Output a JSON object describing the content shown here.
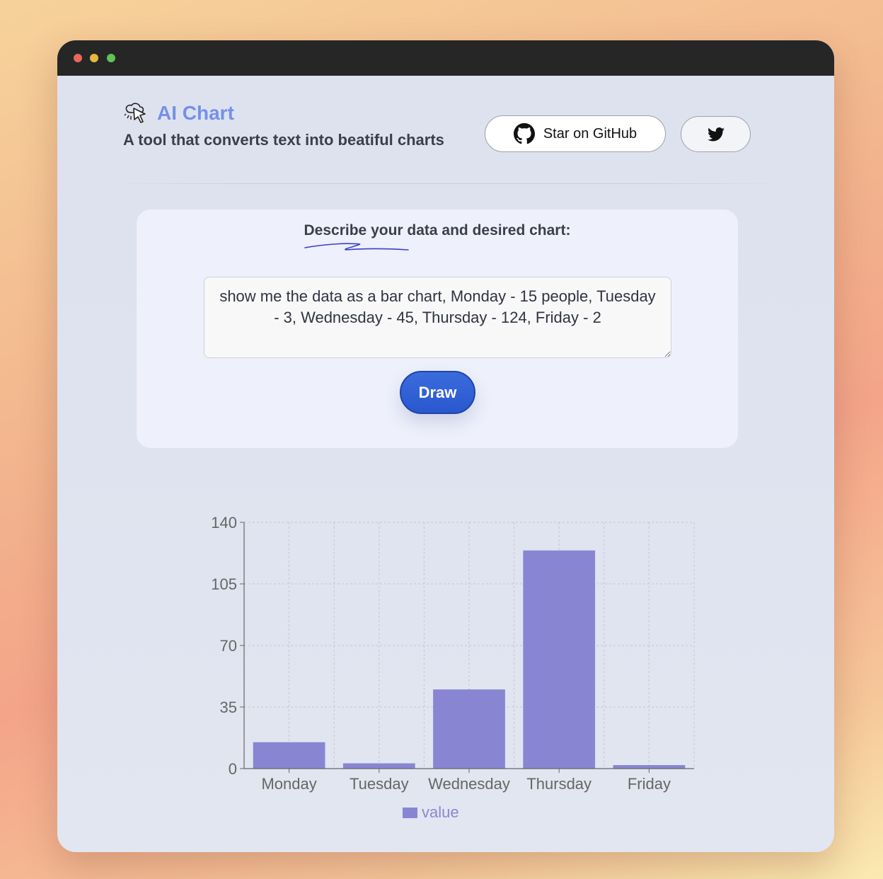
{
  "app": {
    "title": "AI Chart",
    "tagline": "A tool that converts text into beatiful charts",
    "github_label": "Star on GitHub"
  },
  "prompt": {
    "label": "Describe your data and desired chart:",
    "value": "show me the data as a bar chart, Monday - 15 people, Tuesday - 3, Wednesday - 45, Thursday - 124, Friday - 2",
    "button_label": "Draw"
  },
  "colors": {
    "accent": "#7590e8",
    "button": "#2a57cf",
    "bar": "#8886d3"
  },
  "chart_data": {
    "type": "bar",
    "categories": [
      "Monday",
      "Tuesday",
      "Wednesday",
      "Thursday",
      "Friday"
    ],
    "series": [
      {
        "name": "value",
        "values": [
          15,
          3,
          45,
          124,
          2
        ]
      }
    ],
    "ylim": [
      0,
      140
    ],
    "yticks": [
      0,
      35,
      70,
      105,
      140
    ],
    "grid": true,
    "legend": "bottom",
    "legend_label": "value"
  }
}
